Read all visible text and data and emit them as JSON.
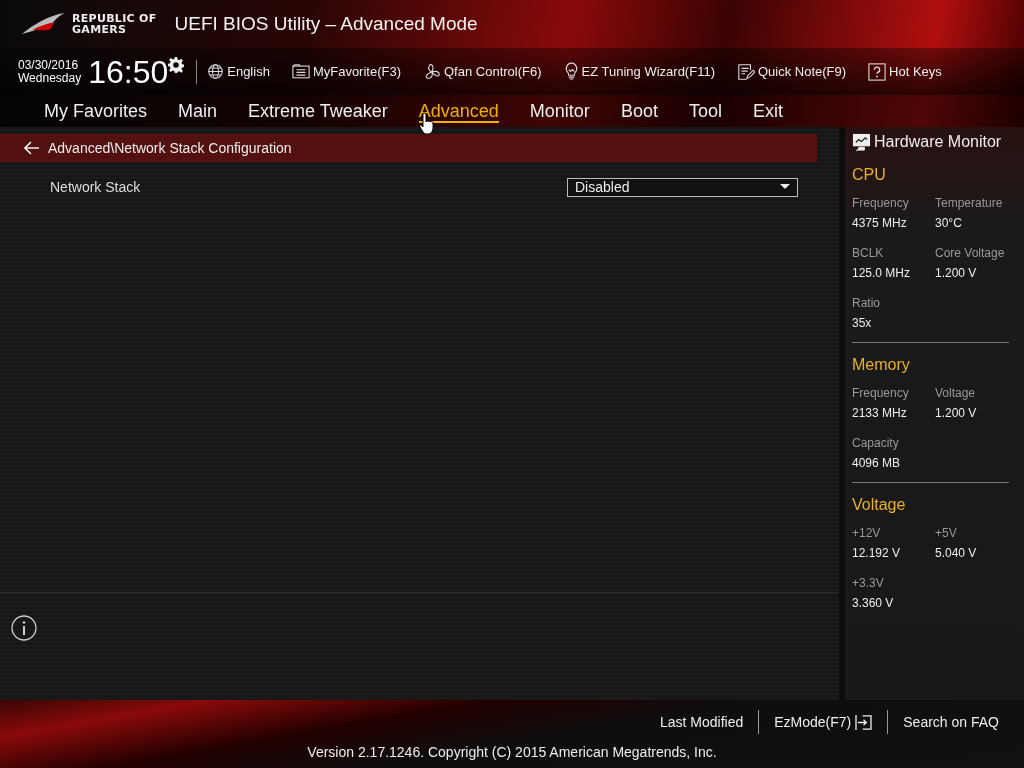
{
  "header": {
    "logo": [
      "REPUBLIC OF",
      "GAMERS"
    ],
    "title": "UEFI BIOS Utility – Advanced Mode"
  },
  "toolbar": {
    "date": "03/30/2016",
    "day": "Wednesday",
    "time": "16:50",
    "items": [
      {
        "kind": "globe",
        "label": "English"
      },
      {
        "kind": "favorite",
        "label": "MyFavorite(F3)"
      },
      {
        "kind": "fan",
        "label": "Qfan Control(F6)"
      },
      {
        "kind": "bulb",
        "label": "EZ Tuning Wizard(F11)"
      },
      {
        "kind": "note",
        "label": "Quick Note(F9)"
      },
      {
        "kind": "help",
        "label": "Hot Keys"
      }
    ]
  },
  "tabs": [
    {
      "label": "My Favorites",
      "selected": false
    },
    {
      "label": "Main",
      "selected": false
    },
    {
      "label": "Extreme Tweaker",
      "selected": false
    },
    {
      "label": "Advanced",
      "selected": true
    },
    {
      "label": "Monitor",
      "selected": false
    },
    {
      "label": "Boot",
      "selected": false
    },
    {
      "label": "Tool",
      "selected": false
    },
    {
      "label": "Exit",
      "selected": false
    }
  ],
  "breadcrumb": "Advanced\\Network Stack Configuration",
  "settings": [
    {
      "label": "Network Stack",
      "value": "Disabled"
    }
  ],
  "hardware_monitor": {
    "title": "Hardware Monitor",
    "sections": [
      {
        "title": "CPU",
        "items": [
          {
            "label": "Frequency",
            "value": "4375 MHz"
          },
          {
            "label": "Temperature",
            "value": "30°C"
          },
          {
            "label": "BCLK",
            "value": "125.0 MHz"
          },
          {
            "label": "Core Voltage",
            "value": "1.200 V"
          },
          {
            "label": "Ratio",
            "value": "35x"
          }
        ]
      },
      {
        "title": "Memory",
        "items": [
          {
            "label": "Frequency",
            "value": "2133 MHz"
          },
          {
            "label": "Voltage",
            "value": "1.200 V"
          },
          {
            "label": "Capacity",
            "value": "4096 MB"
          }
        ]
      },
      {
        "title": "Voltage",
        "items": [
          {
            "label": "+12V",
            "value": "12.192 V"
          },
          {
            "label": "+5V",
            "value": "5.040 V"
          },
          {
            "label": "+3.3V",
            "value": "3.360 V"
          }
        ]
      }
    ]
  },
  "footer": {
    "links": [
      {
        "kind": "plain",
        "label": "Last Modified"
      },
      {
        "kind": "exit",
        "label": "EzMode(F7)"
      },
      {
        "kind": "plain",
        "label": "Search on FAQ"
      }
    ],
    "version": "Version 2.17.1246. Copyright (C) 2015 American Megatrends, Inc."
  }
}
